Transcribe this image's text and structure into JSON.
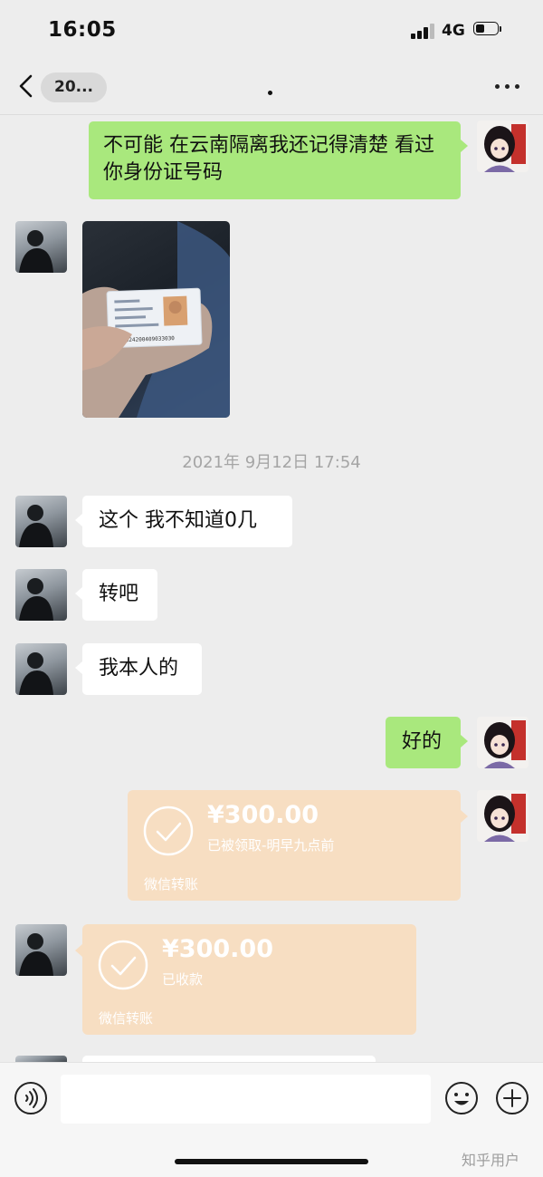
{
  "status_bar": {
    "time": "16:05",
    "network": "4G",
    "icons": [
      "signal-icon",
      "battery-icon"
    ]
  },
  "nav": {
    "back_icon": "chevron-left-icon",
    "chat_name": "20...",
    "more_icon": "more-dots-icon"
  },
  "messages": [
    {
      "sender": "self",
      "type": "text",
      "text": "不可能 在云南隔离我还记得清楚 看过你身份证号码"
    },
    {
      "sender": "contact",
      "type": "image",
      "image_text": "350524200409033030"
    },
    {
      "type": "timestamp",
      "text": "2021年 9月12日 17:54"
    },
    {
      "sender": "contact",
      "type": "text",
      "text": "这个 我不知道0几"
    },
    {
      "sender": "contact",
      "type": "text",
      "text": "转吧"
    },
    {
      "sender": "contact",
      "type": "text",
      "text": "我本人的"
    },
    {
      "sender": "self",
      "type": "text",
      "text": "好的"
    },
    {
      "sender": "self",
      "type": "transfer",
      "amount": "¥300.00",
      "status": "已被领取-明早九点前",
      "label": "微信转账"
    },
    {
      "sender": "contact",
      "type": "transfer",
      "amount": "¥300.00",
      "status": "已收款",
      "label": "微信转账"
    }
  ],
  "input_bar": {
    "voice_icon": "voice-icon",
    "input_value": "",
    "emoji_icon": "emoji-icon",
    "plus_icon": "plus-icon"
  },
  "watermark": "知乎用户",
  "colors": {
    "background": "#ededed",
    "self_bubble": "#a9e87d",
    "contact_bubble": "#ffffff",
    "transfer": "#f7dec2",
    "timestamp": "#a5a5a5"
  }
}
